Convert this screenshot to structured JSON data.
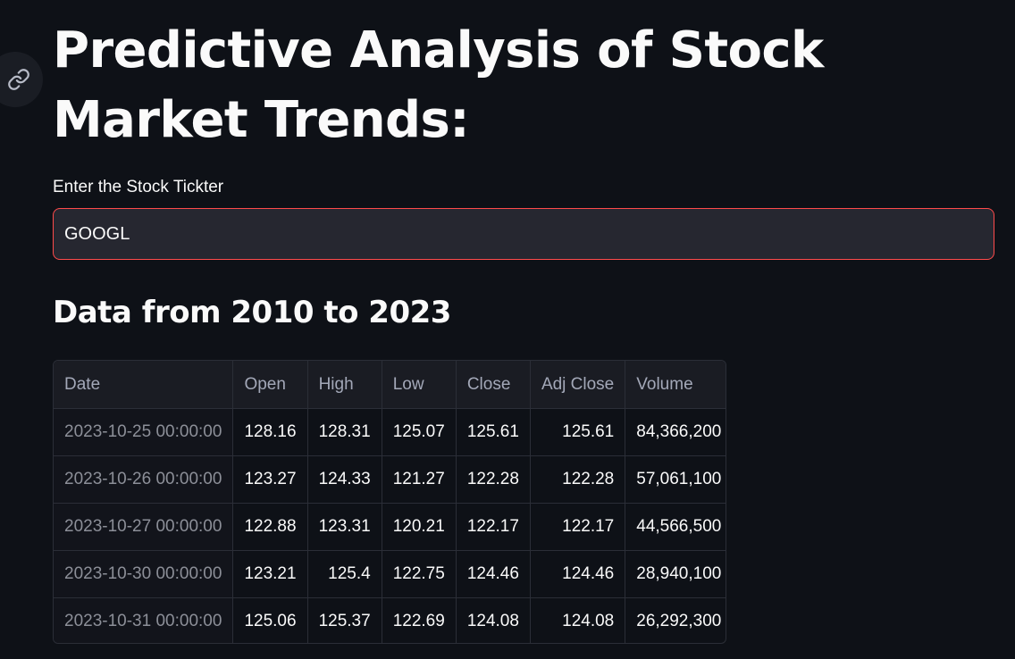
{
  "page": {
    "title": "Predictive Analysis of Stock Market Trends:",
    "anchor_icon": "link-icon"
  },
  "ticker": {
    "label": "Enter the Stock Tickter",
    "value": "GOOGL"
  },
  "data_section": {
    "heading": "Data from 2010 to 2023"
  },
  "table": {
    "columns": [
      "Date",
      "Open",
      "High",
      "Low",
      "Close",
      "Adj Close",
      "Volume"
    ],
    "rows": [
      [
        "2023-10-25 00:00:00",
        "128.16",
        "128.31",
        "125.07",
        "125.61",
        "125.61",
        "84,366,200"
      ],
      [
        "2023-10-26 00:00:00",
        "123.27",
        "124.33",
        "121.27",
        "122.28",
        "122.28",
        "57,061,100"
      ],
      [
        "2023-10-27 00:00:00",
        "122.88",
        "123.31",
        "120.21",
        "122.17",
        "122.17",
        "44,566,500"
      ],
      [
        "2023-10-30 00:00:00",
        "123.21",
        "125.4",
        "122.75",
        "124.46",
        "124.46",
        "28,940,100"
      ],
      [
        "2023-10-31 00:00:00",
        "125.06",
        "125.37",
        "122.69",
        "124.08",
        "124.08",
        "26,292,300"
      ]
    ]
  },
  "colors": {
    "background": "#0e1117",
    "input_background": "#262730",
    "input_focus_border": "#ff4b4b",
    "text": "#fafafa",
    "muted_text": "#a3a8b8"
  }
}
